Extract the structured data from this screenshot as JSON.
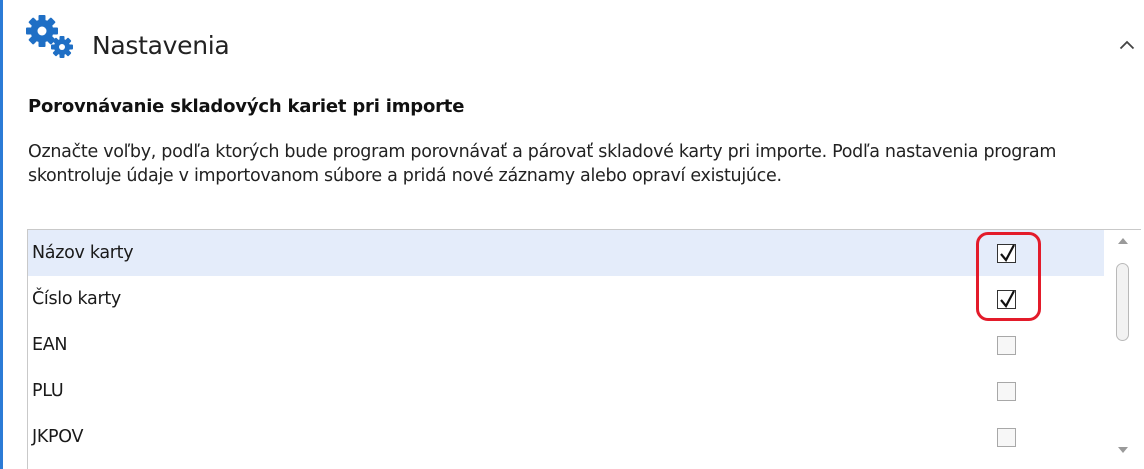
{
  "panel": {
    "title": "Nastavenia",
    "icon": "gears-icon",
    "collapse_icon": "chevron-up-icon"
  },
  "section": {
    "heading": "Porovnávanie skladových kariet pri importe",
    "description": "Označte voľby, podľa ktorých bude program porovnávať a párovať skladové karty pri importe. Podľa nastavenia program skontroluje údaje v importovanom súbore a pridá nové záznamy alebo opraví existujúce."
  },
  "options": [
    {
      "label": "Názov karty",
      "checked": true,
      "selected": true
    },
    {
      "label": "Číslo karty",
      "checked": true,
      "selected": false
    },
    {
      "label": "EAN",
      "checked": false,
      "selected": false
    },
    {
      "label": "PLU",
      "checked": false,
      "selected": false
    },
    {
      "label": "JKPOV",
      "checked": false,
      "selected": false
    }
  ],
  "colors": {
    "accent": "#2b7bd6",
    "icon_blue": "#1f6fc5",
    "selected_row": "#e4ecfa",
    "highlight": "#e31b2a"
  }
}
